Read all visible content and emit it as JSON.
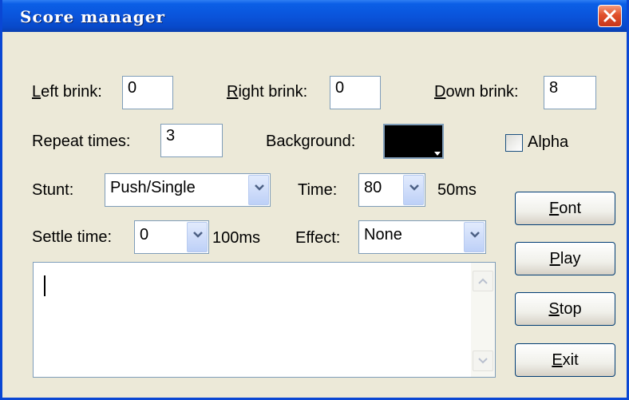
{
  "window": {
    "title": "Score manager",
    "close_icon": "close-icon"
  },
  "fields": {
    "left_brink": {
      "label_u": "L",
      "label_rest": "eft brink:",
      "value": "0"
    },
    "right_brink": {
      "label_u": "R",
      "label_rest": "ight brink:",
      "value": "0"
    },
    "down_brink": {
      "label_u": "D",
      "label_rest": "own brink:",
      "value": "8"
    },
    "repeat_times": {
      "label": "Repeat times:",
      "value": "3"
    },
    "background": {
      "label": "Background:",
      "color": "#000000"
    },
    "alpha": {
      "label": "Alpha",
      "checked": false
    },
    "stunt": {
      "label": "Stunt:",
      "value": "Push/Single"
    },
    "time": {
      "label": "Time:",
      "value": "80",
      "unit": "50ms"
    },
    "settle_time": {
      "label": "Settle time:",
      "value": "0",
      "unit": "100ms"
    },
    "effect": {
      "label": "Effect:",
      "value": "None"
    }
  },
  "buttons": {
    "font": {
      "u": "F",
      "rest": "ont"
    },
    "play": {
      "u": "P",
      "rest": "lay"
    },
    "stop": {
      "u": "S",
      "rest": "top"
    },
    "exit": {
      "u": "E",
      "rest": "xit"
    }
  },
  "memo": {
    "value": ""
  },
  "colors": {
    "titlebar": "#0a54db",
    "face": "#ece9d8",
    "border": "#7f9db9"
  }
}
